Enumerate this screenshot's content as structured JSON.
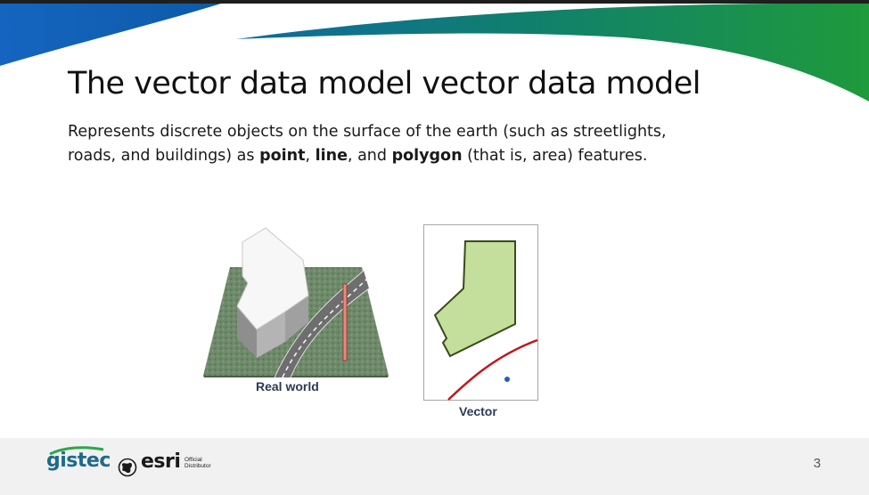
{
  "slide": {
    "title": "The vector data model vector data model",
    "body": {
      "part1": "Represents discrete objects on the surface of the earth (such as streetlights, roads, and buildings) as ",
      "point": "point",
      "sep1": ", ",
      "line": "line",
      "sep2": ", and ",
      "polygon": "polygon",
      "part2": " (that is, area) features."
    },
    "figures": {
      "real_world_caption": "Real world",
      "vector_caption": "Vector"
    },
    "colors": {
      "accent_blue": "#1565c0",
      "accent_green": "#1e8a3a",
      "polygon_fill": "#c4df9b",
      "polygon_stroke": "#3a4a1e",
      "line_red": "#c0181d",
      "point_blue": "#1f5fbf"
    }
  },
  "footer": {
    "brand1": "gistec",
    "brand2": "esri",
    "brand2_tag": "Official Distributor",
    "page_number": "3"
  }
}
